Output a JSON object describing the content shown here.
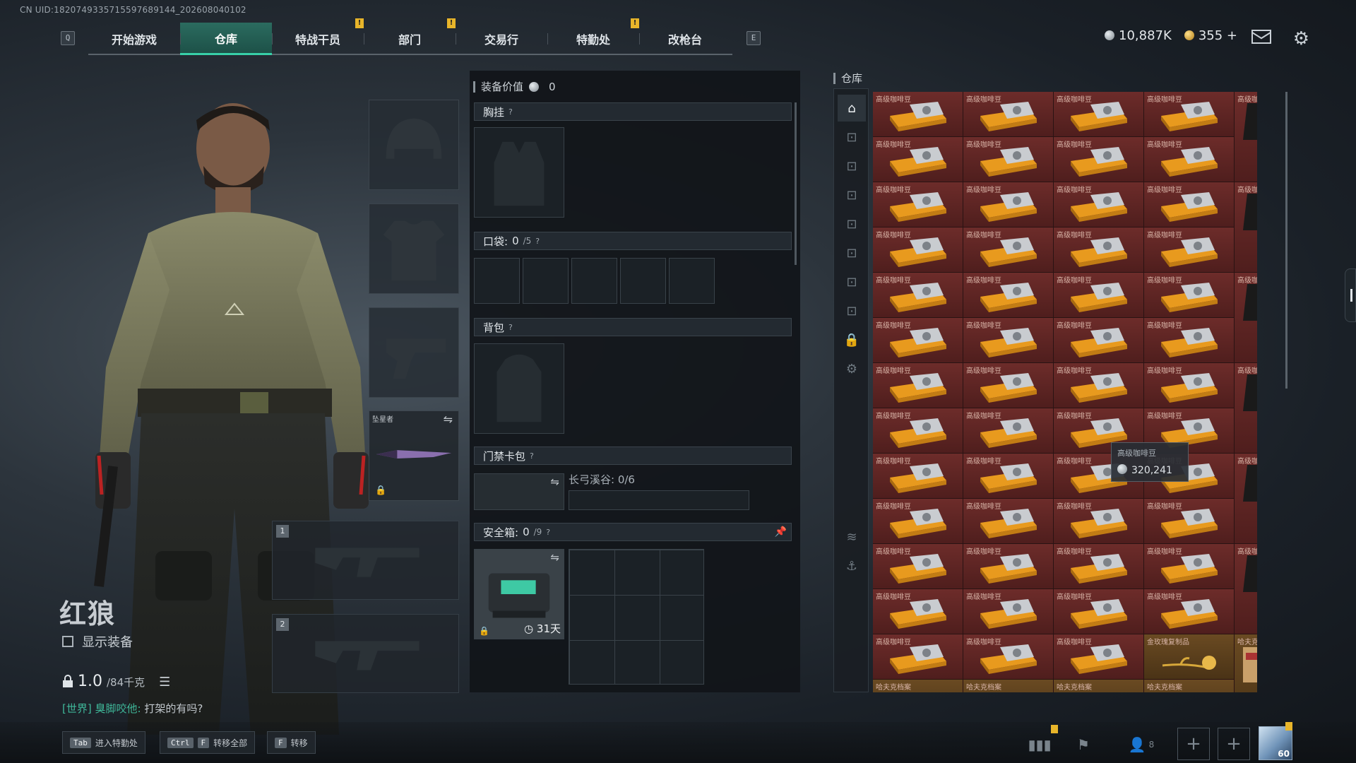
{
  "uid": "CN UID:1820749335715597689144_202608040102",
  "nav": {
    "left_key": "Q",
    "right_key": "E",
    "tabs": [
      {
        "label": "开始游戏",
        "badge": false
      },
      {
        "label": "仓库",
        "badge": false,
        "active": true
      },
      {
        "label": "特战干员",
        "badge": true
      },
      {
        "label": "部门",
        "badge": true
      },
      {
        "label": "交易行",
        "badge": false
      },
      {
        "label": "特勤处",
        "badge": true
      },
      {
        "label": "改枪台",
        "badge": false
      }
    ],
    "badge_mark": "!"
  },
  "currency": {
    "silver": "10,887K",
    "gold": "355",
    "add": "+"
  },
  "character": {
    "name": "红狼",
    "show_equipment": "显示装备",
    "weight_current": "1.0",
    "weight_max": "/84千克"
  },
  "chat": {
    "channel": "[世界]",
    "user": "臭脚咬他:",
    "message": "打架的有吗?"
  },
  "loadout": {
    "weapon_star_name": "坠星者",
    "slot1": "1",
    "slot2": "2"
  },
  "gear_panel": {
    "value_label": "装备价值",
    "value": "0",
    "chest_rig": "胸挂",
    "pocket_label": "口袋:",
    "pocket_count": "0",
    "pocket_cap": "/5",
    "backpack": "背包",
    "keycard": "门禁卡包",
    "keycard_map": "长弓溪谷: 0/6",
    "safebox_label": "安全箱:",
    "safebox_count": "0",
    "safebox_cap": "/9",
    "safebox_days": "31天",
    "help": "?"
  },
  "warehouse": {
    "title": "仓库",
    "item_name": "高级咖啡豆",
    "rose_name": "金玫瑰复制品",
    "file_name": "哈夫克档案",
    "tooltip_name": "高级咖啡豆",
    "tooltip_value": "320,241",
    "side_tabs": [
      "home",
      "gun1",
      "gun2",
      "gun3",
      "gun4",
      "gun5",
      "gun6",
      "gun7",
      "lock",
      "gear",
      "layers",
      "anchor"
    ]
  },
  "bottom": {
    "hotkeys": [
      {
        "keys": [
          "Tab"
        ],
        "label": "进入特勤处"
      },
      {
        "keys": [
          "Ctrl",
          "F"
        ],
        "label": "转移全部"
      },
      {
        "keys": [
          "F"
        ],
        "label": "转移"
      }
    ],
    "friends_count": "8",
    "level": "60"
  },
  "colors": {
    "accent": "#38d0a8",
    "badge": "#e8b52a",
    "item_bg": "#6d2c2a"
  }
}
